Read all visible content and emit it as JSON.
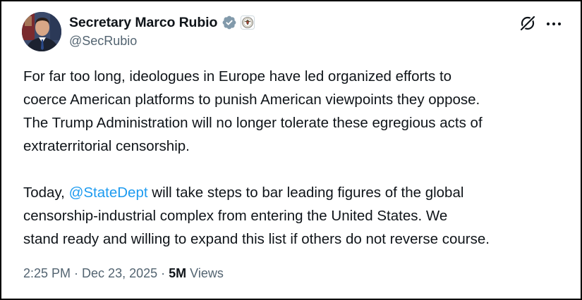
{
  "tweet": {
    "author": {
      "display_name": "Secretary Marco Rubio",
      "handle": "@SecRubio",
      "verified_badge_icon": "verified-badge-icon",
      "affiliation_icon": "us-department-of-state-seal-icon",
      "colors": {
        "verified_badge": "#829aab"
      }
    },
    "header_actions": {
      "grok_icon": "grok-icon",
      "more_icon": "more-options-icon"
    },
    "body": {
      "paragraph_1": [
        "For far too long, ideologues in Europe have led organized efforts to",
        "coerce American platforms to punish American viewpoints they oppose.",
        "The Trump Administration will no longer tolerate these egregious acts of",
        "extraterritorial censorship."
      ],
      "paragraph_2": {
        "line_1_prefix": "Today, ",
        "mention": "@StateDept",
        "line_1_suffix": " will take steps to bar leading figures of the global",
        "line_2": "censorship-industrial complex from entering the United States. We",
        "line_3": "stand ready and willing to expand this list if others do not reverse course."
      }
    },
    "meta": {
      "time": "2:25 PM",
      "separator": "·",
      "date": "Dec 23, 2025",
      "views_count": "5M",
      "views_label": "Views"
    },
    "colors": {
      "text_primary": "#0f1419",
      "text_secondary": "#536471",
      "link": "#1d9bf0",
      "frame_border": "#000000"
    }
  }
}
